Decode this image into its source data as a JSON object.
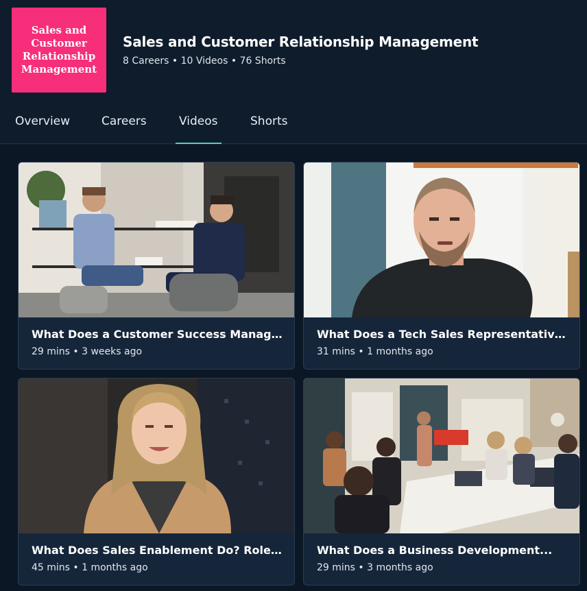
{
  "topic": {
    "logo_text": "Sales and Customer Relationship Management",
    "title": "Sales and Customer Relationship Management",
    "meta": "8 Careers • 10 Videos • 76 Shorts",
    "brand_color": "#f72e7a"
  },
  "tabs": [
    {
      "label": "Overview",
      "active": false
    },
    {
      "label": "Careers",
      "active": false
    },
    {
      "label": "Videos",
      "active": true
    },
    {
      "label": "Shorts",
      "active": false
    }
  ],
  "accent_color": "#4fd1c5",
  "videos": [
    {
      "title": "What Does a Customer Success Manager...",
      "meta": "29 mins • 3 weeks ago",
      "thumbnail": "two-men-interview-photo"
    },
    {
      "title": "What Does a Tech Sales Representative...",
      "meta": "31 mins • 1 months ago",
      "thumbnail": "man-webcam-photo"
    },
    {
      "title": "What Does Sales Enablement Do? Roles,...",
      "meta": "45 mins • 1 months ago",
      "thumbnail": "woman-smiling-photo"
    },
    {
      "title": "What Does a Business Development...",
      "meta": "29 mins • 3 months ago",
      "thumbnail": "office-meeting-photo"
    }
  ]
}
